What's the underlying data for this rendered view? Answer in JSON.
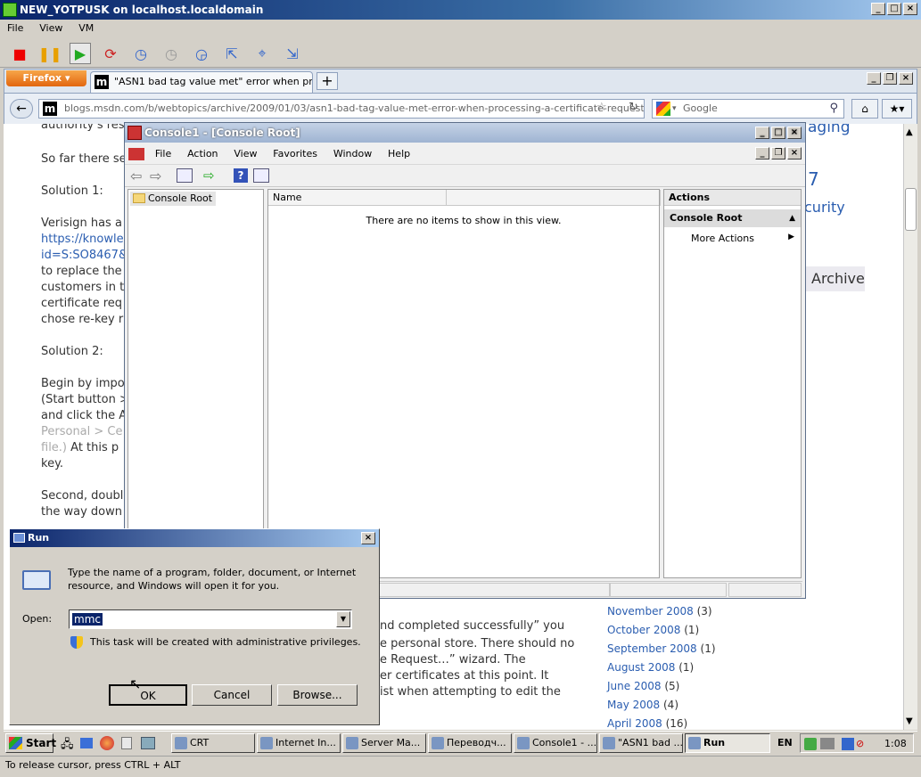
{
  "vm": {
    "title": "NEW_YOTPUSK on localhost.localdomain",
    "menu": [
      "File",
      "View",
      "VM"
    ]
  },
  "firefox": {
    "button": "Firefox",
    "tab_title": "\"ASN1 bad tag value met\" error when proce...",
    "url": "blogs.msdn.com/b/webtopics/archive/2009/01/03/asn1-bad-tag-value-met-error-when-processing-a-certificate-request-in",
    "search_placeholder": "Google"
  },
  "page": {
    "lines": [
      "authority's res",
      "So far there se",
      "Solution 1:",
      "Verisign has a",
      "to replace the",
      "customers in t",
      "certificate req",
      "chose re-key r",
      "Solution 2:",
      "Begin by impo",
      "(Start button >",
      "and click the A",
      "key.",
      "Second, doubl",
      "the way down"
    ],
    "links": [
      "https://knowle",
      "id=S:SO8467&"
    ],
    "faded": [
      "Personal > Ce",
      "file.)"
    ],
    "faded_tail": "At this p",
    "right_fragments": [
      "aging",
      "7",
      "curity"
    ],
    "archive_label": "Archive",
    "lower_lines": [
      "nd completed successfully” you",
      "e personal store. There should no",
      "e Request…” wizard.  The",
      "er certificates at this point.  It",
      "ist when attempting to edit the"
    ],
    "archive_list": [
      {
        "month": "November 2008",
        "count": "(3)"
      },
      {
        "month": "October 2008",
        "count": "(1)"
      },
      {
        "month": "September 2008",
        "count": "(1)"
      },
      {
        "month": "August 2008",
        "count": "(1)"
      },
      {
        "month": "June 2008",
        "count": "(5)"
      },
      {
        "month": "May 2008",
        "count": "(4)"
      },
      {
        "month": "April 2008",
        "count": "(16)"
      }
    ]
  },
  "mmc": {
    "title": "Console1 - [Console Root]",
    "menu": [
      "File",
      "Action",
      "View",
      "Favorites",
      "Window",
      "Help"
    ],
    "tree_root": "Console Root",
    "list_header": "Name",
    "empty_text": "There are no items to show in this view.",
    "actions_header": "Actions",
    "actions_section": "Console Root",
    "more_actions": "More Actions"
  },
  "run": {
    "title": "Run",
    "description_line1": "Type the name of a program, folder, document, or Internet",
    "description_line2": "resource, and Windows will open it for you.",
    "open_label": "Open:",
    "open_value": "mmc",
    "admin_note": "This task will be created with administrative privileges.",
    "ok": "OK",
    "cancel": "Cancel",
    "browse": "Browse..."
  },
  "taskbar": {
    "start": "Start",
    "tasks": [
      "CRT",
      "Internet In...",
      "Server Ma...",
      "Переводч...",
      "Console1 - ...",
      "\"ASN1 bad ...",
      "Run"
    ],
    "lang": "EN",
    "clock": "1:08"
  },
  "status": "To release cursor, press CTRL + ALT"
}
